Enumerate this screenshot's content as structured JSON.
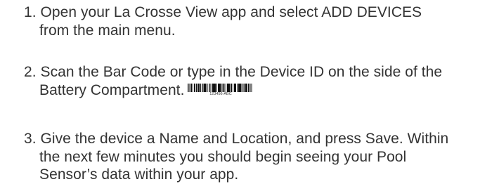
{
  "steps": [
    {
      "number": "1.",
      "line1": "Open your La Crosse View app and select ADD DEVICES",
      "line2": "from the main menu."
    },
    {
      "number": "2.",
      "line1": "Scan the Bar Code or type in the Device ID on the side of the",
      "line2": "Battery Compartment.",
      "barcode_text": "123456-ABC"
    },
    {
      "number": "3.",
      "line1": "Give the device a Name and Location, and press Save. Within",
      "line2": "the next few minutes you should begin seeing your Pool",
      "line3": "Sensor’s data within your app."
    }
  ]
}
